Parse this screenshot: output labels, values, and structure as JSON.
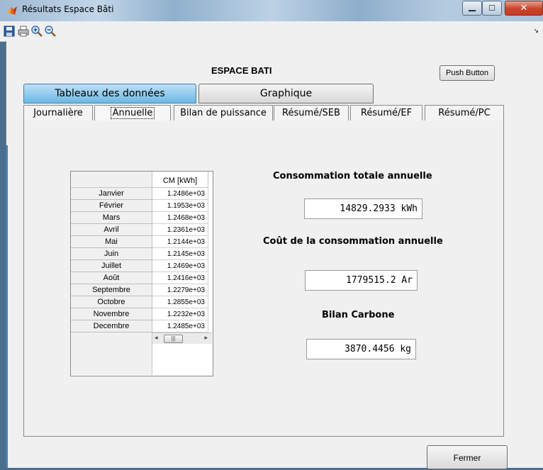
{
  "window": {
    "title": "Résultats Espace Bâti"
  },
  "heading": "ESPACE BATI",
  "push_button": "Push Button",
  "main_tabs": [
    {
      "label": "Tableaux des données"
    },
    {
      "label": "Graphique"
    }
  ],
  "sub_tabs": [
    {
      "label": "Journalière"
    },
    {
      "label": "Annuelle"
    },
    {
      "label": "Bilan de puissance"
    },
    {
      "label": "Résumé/SEB"
    },
    {
      "label": "Résumé/EF"
    },
    {
      "label": "Résumé/PC"
    }
  ],
  "table": {
    "column_header": "CM [kWh]",
    "rows": [
      {
        "month": "Janvier",
        "value": "1.2486e+03"
      },
      {
        "month": "Février",
        "value": "1.1953e+03"
      },
      {
        "month": "Mars",
        "value": "1.2468e+03"
      },
      {
        "month": "Avril",
        "value": "1.2361e+03"
      },
      {
        "month": "Mai",
        "value": "1.2144e+03"
      },
      {
        "month": "Juin",
        "value": "1.2145e+03"
      },
      {
        "month": "Juillet",
        "value": "1.2469e+03"
      },
      {
        "month": "Août",
        "value": "1.2416e+03"
      },
      {
        "month": "Septembre",
        "value": "1.2279e+03"
      },
      {
        "month": "Octobre",
        "value": "1.2855e+03"
      },
      {
        "month": "Novembre",
        "value": "1.2232e+03"
      },
      {
        "month": "Decembre",
        "value": "1.2485e+03"
      }
    ]
  },
  "summary": {
    "consumption_label": "Consommation totale annuelle",
    "consumption_value": "14829.2933 kWh",
    "cost_label": "Coût de la consommation annuelle",
    "cost_value": "1779515.2 Ar",
    "carbon_label": "Bilan Carbone",
    "carbon_value": "3870.4456 kg"
  },
  "close_button": "Fermer",
  "icons": [
    "matlab-app-icon",
    "save-icon",
    "print-icon",
    "zoom-in-icon",
    "zoom-out-icon",
    "minimize-icon",
    "maximize-icon",
    "close-icon"
  ]
}
